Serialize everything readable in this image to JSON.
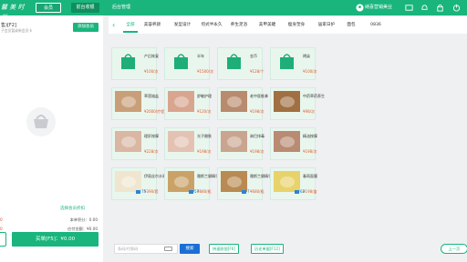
{
  "topbar": {
    "brand": "馨 美 时 尚",
    "member_label": "会员",
    "cashier_label": "前台收银",
    "backend_label": "后台管理",
    "shop_name": "纳喜营销美业"
  },
  "left": {
    "order_no": "售)[F2]",
    "order_sub": "子会员暂或新会员卡",
    "add_member": "添加会员",
    "select_vip": "选择会员折扣",
    "vip_points_label": "本单积分：0.00",
    "pay_amount_label": "应付金额：¥0.00",
    "left_amount": "0",
    "left_amount_label": "0",
    "checkout": "买单[F5]：¥0.00"
  },
  "categories": [
    "全部",
    "美容养颜",
    "发型设计",
    "何式半永久",
    "养生足浴",
    "美甲美睫",
    "瘦身塑身",
    "居家日护",
    "面包",
    "0836"
  ],
  "products": [
    {
      "name": "产后恢复",
      "price": "¥100/次",
      "stock": "",
      "img": "bag"
    },
    {
      "name": "半年",
      "price": "¥1500/次",
      "stock": "",
      "img": "bag"
    },
    {
      "name": "金币",
      "price": "¥128/个",
      "stock": "",
      "img": "bag"
    },
    {
      "name": "绣染",
      "price": "¥100/次",
      "stock": "",
      "img": "bag"
    },
    {
      "name": "草莲熔盐",
      "price": "¥2000/疗程",
      "stock": "",
      "img": "photo1"
    },
    {
      "name": "舒敏护理",
      "price": "¥120/次",
      "stock": "",
      "img": "photo2"
    },
    {
      "name": "老中医推拿",
      "price": "¥198/次",
      "stock": "",
      "img": "photo3"
    },
    {
      "name": "中药草药养生",
      "price": "¥98/次",
      "stock": "",
      "img": "photo4"
    },
    {
      "name": "理肝按摩",
      "price": "¥228/次",
      "stock": "",
      "img": "photo5"
    },
    {
      "name": "光子嫩肤",
      "price": "¥198/次",
      "stock": "",
      "img": "photo6"
    },
    {
      "name": "淋巴排毒",
      "price": "¥198/次",
      "stock": "",
      "img": "photo7"
    },
    {
      "name": "精油按摩",
      "price": "¥198/次",
      "stock": "",
      "img": "photo8"
    },
    {
      "name": "伊丽丝尔水乳",
      "price": "¥390/套",
      "stock": "75",
      "img": "photo9"
    },
    {
      "name": "雅斯兰黛精华液",
      "price": "¥880/瓶",
      "stock": "57",
      "img": "photo10"
    },
    {
      "name": "雅斯兰黛精华液",
      "price": "¥680/瓶",
      "stock": "7",
      "img": "photo11"
    },
    {
      "name": "春雨面膜",
      "price": "¥198/盒",
      "stock": "62",
      "img": "photo12"
    }
  ],
  "bottom": {
    "search_placeholder": "条码/付款码",
    "search_btn": "搜索",
    "quick_btn": "快速收银[F6]",
    "history_btn": "历史单据[F12]",
    "prev_page": "上一页"
  }
}
